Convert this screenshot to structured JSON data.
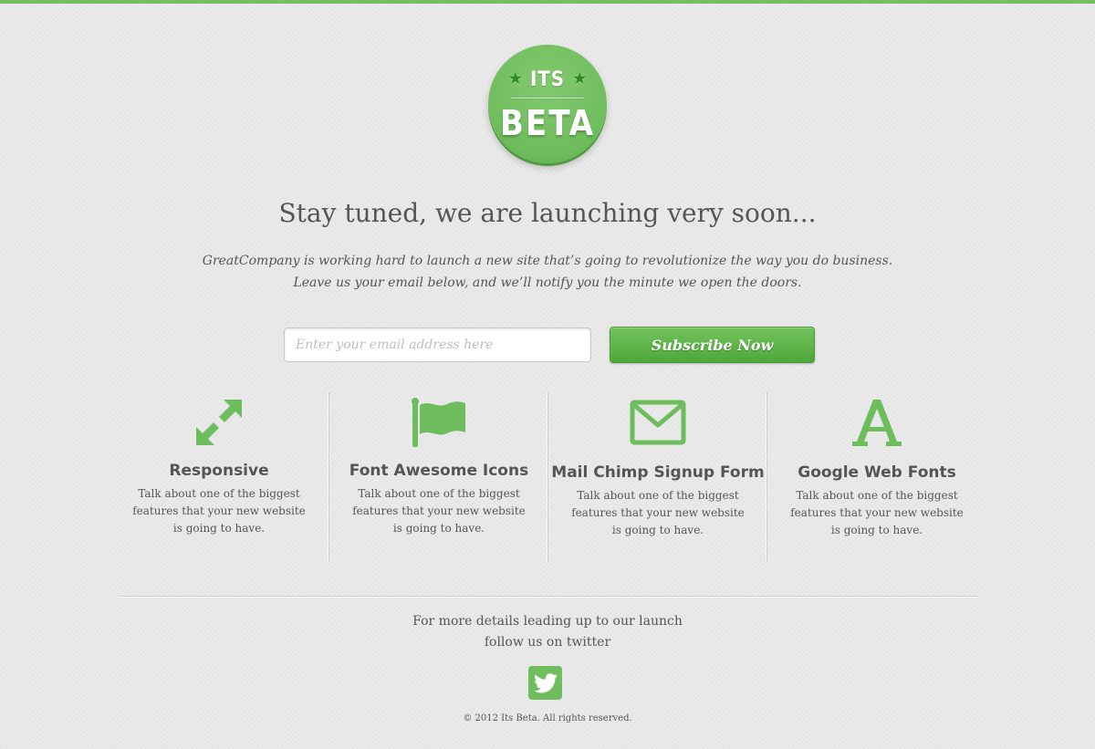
{
  "logo": {
    "top_text": "ITS",
    "main_text": "BETA"
  },
  "hero": {
    "headline": "Stay tuned, we are launching very soon...",
    "intro_line_1": "GreatCompany is working hard to launch a new site that’s going to revolutionize the way you do business.",
    "intro_line_2": "Leave us your email below, and we’ll notify you the minute we open the doors."
  },
  "signup": {
    "email_placeholder": "Enter your email address here",
    "email_value": "",
    "button_label": "Subscribe Now"
  },
  "features": [
    {
      "icon": "expand-arrows-icon",
      "title": "Responsive",
      "desc_1": "Talk about one of the biggest",
      "desc_2": "features that your new website",
      "desc_3": "is going to have."
    },
    {
      "icon": "flag-icon",
      "title": "Font Awesome Icons",
      "desc_1": "Talk about one of the biggest",
      "desc_2": "features that your new website",
      "desc_3": "is going to have."
    },
    {
      "icon": "envelope-icon",
      "title": "Mail Chimp Signup Form",
      "desc_1": "Talk about one of the biggest",
      "desc_2": "features that your new website",
      "desc_3": "is going to have."
    },
    {
      "icon": "font-letter-a-icon",
      "title": "Google Web Fonts",
      "desc_1": "Talk about one of the biggest",
      "desc_2": "features that your new website",
      "desc_3": "is going to have."
    }
  ],
  "footer": {
    "follow_line_1": "For more details leading up to our launch",
    "follow_line_2": "follow us on twitter",
    "twitter_icon": "twitter-bird-icon",
    "copyright": "© 2012 Its Beta. All rights reserved."
  },
  "colors": {
    "accent_green": "#74c165",
    "button_green": "#4ea83a",
    "background": "#e9e8e8",
    "text": "#555555"
  }
}
